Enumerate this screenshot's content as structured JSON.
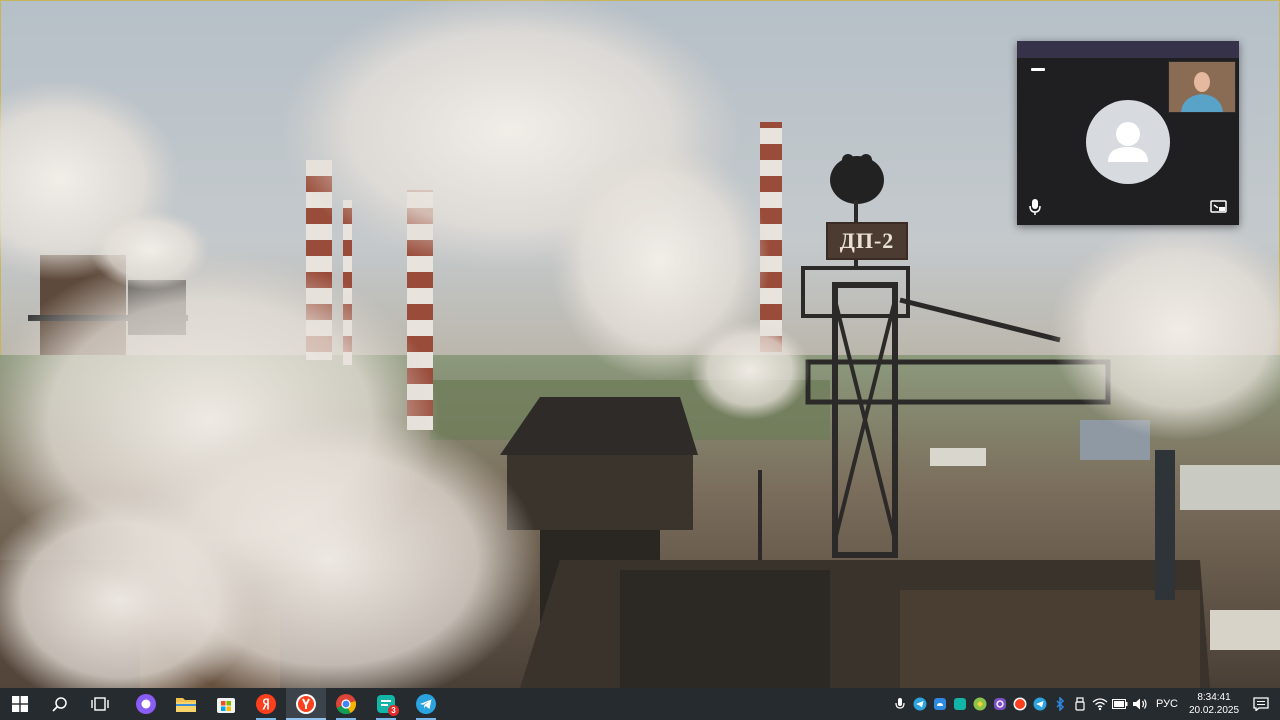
{
  "video": {
    "furnace_sign": "ДП-2"
  },
  "call": {
    "icons": {
      "minimize": "minimize-icon",
      "avatar": "user-avatar-icon",
      "mic": "microphone-icon",
      "share": "screen-share-icon"
    }
  },
  "taskbar": {
    "apps": [
      {
        "name": "start",
        "icon": "windows-icon"
      },
      {
        "name": "search",
        "icon": "search-icon"
      },
      {
        "name": "task-view",
        "icon": "task-view-icon"
      },
      {
        "name": "alice",
        "icon": "alice-icon"
      },
      {
        "name": "file-explorer",
        "icon": "folder-icon"
      },
      {
        "name": "store",
        "icon": "store-icon"
      },
      {
        "name": "yandex",
        "icon": "yandex-icon"
      },
      {
        "name": "yandex-browser",
        "icon": "yandex-browser-icon",
        "active": true
      },
      {
        "name": "chrome",
        "icon": "chrome-icon"
      },
      {
        "name": "messenger",
        "icon": "messenger-icon",
        "badge": "3"
      },
      {
        "name": "telegram",
        "icon": "telegram-icon"
      }
    ],
    "tray": {
      "language": "РУС",
      "time": "8:34:41",
      "date": "20.02.2025"
    }
  }
}
